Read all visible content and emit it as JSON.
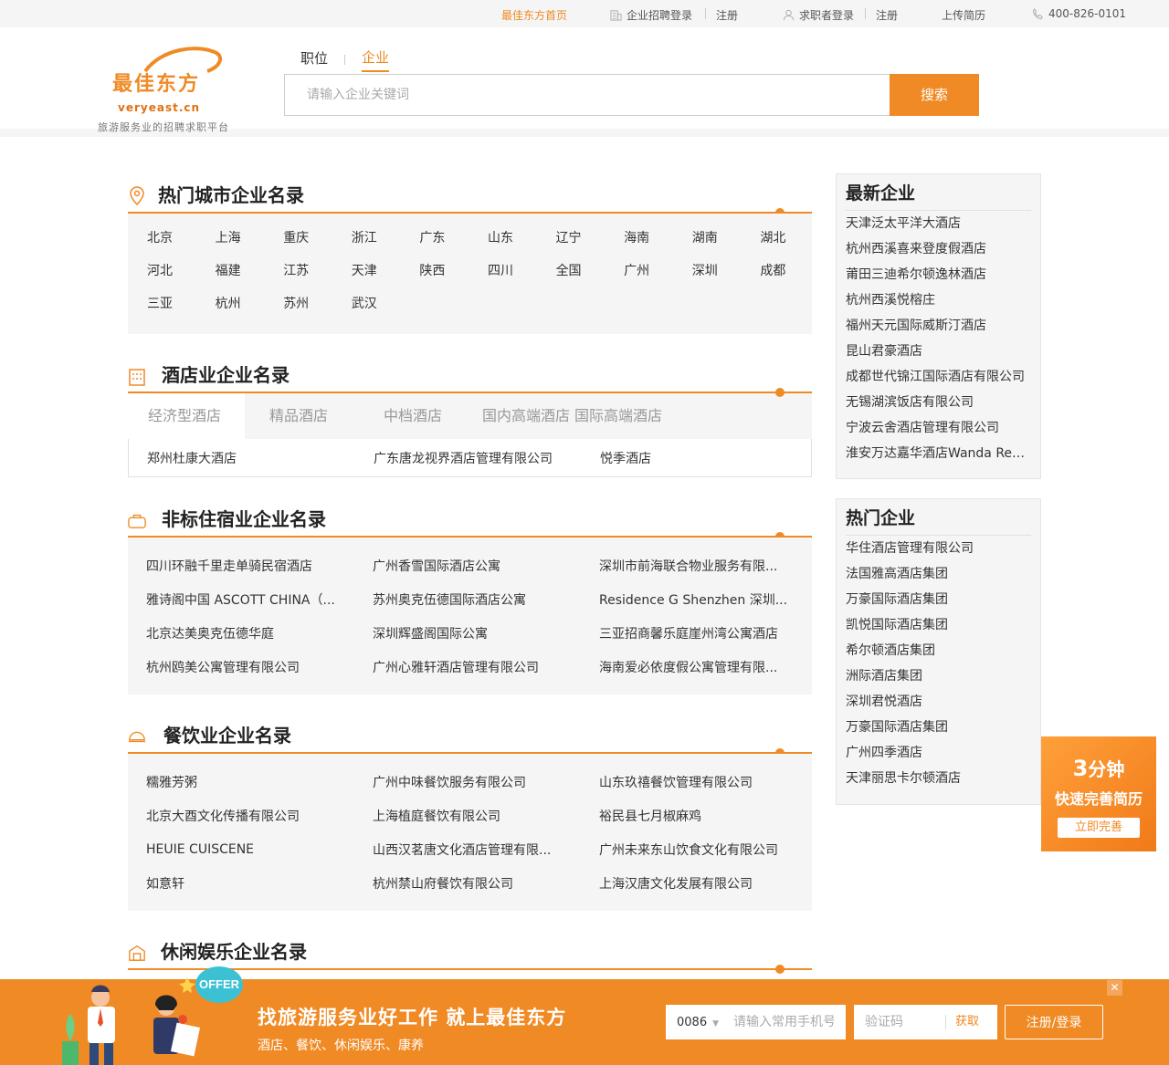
{
  "topbar": {
    "home": "最佳东方首页",
    "employer_login": "企业招聘登录",
    "employer_register": "注册",
    "seeker_login": "求职者登录",
    "seeker_register": "注册",
    "upload_resume": "上传简历",
    "phone": "400-826-0101"
  },
  "logo": {
    "cn": "最佳东方",
    "en": "veryeast.cn",
    "tagline": "旅游服务业的招聘求职平台"
  },
  "search": {
    "tabs": [
      "职位",
      "企业"
    ],
    "active_tab": "企业",
    "placeholder": "请输入企业关键词",
    "button": "搜索"
  },
  "sections": {
    "hot_cities": {
      "title": "热门城市企业名录",
      "cities": [
        [
          "北京",
          "上海",
          "重庆",
          "浙江",
          "广东",
          "山东",
          "辽宁",
          "海南",
          "湖南",
          "湖北"
        ],
        [
          "河北",
          "福建",
          "江苏",
          "天津",
          "陕西",
          "四川",
          "全国",
          "广州",
          "深圳",
          "成都"
        ],
        [
          "三亚",
          "杭州",
          "苏州",
          "武汉"
        ]
      ]
    },
    "hotel": {
      "title": "酒店业企业名录",
      "tabs": [
        "经济型酒店",
        "精品酒店",
        "中档酒店",
        "国内高端酒店",
        "国际高端酒店"
      ],
      "active_tab": "经济型酒店",
      "items": [
        "郑州杜康大酒店",
        "广东唐龙视界酒店管理有限公司",
        "悦季酒店"
      ]
    },
    "nonstandard": {
      "title": "非标住宿业企业名录",
      "items": [
        [
          "四川环融千里走单骑民宿酒店",
          "广州香雪国际酒店公寓",
          "深圳市前海联合物业服务有限..."
        ],
        [
          "雅诗阁中国 ASCOTT CHINA（...",
          "苏州奥克伍德国际酒店公寓",
          "Residence G Shenzhen 深圳..."
        ],
        [
          "北京达美奥克伍德华庭",
          "深圳辉盛阁国际公寓",
          "三亚招商馨乐庭崖州湾公寓酒店"
        ],
        [
          "杭州鸥美公寓管理有限公司",
          "广州心雅轩酒店管理有限公司",
          "海南爱必依度假公寓管理有限..."
        ]
      ]
    },
    "catering": {
      "title": "餐饮业企业名录",
      "items": [
        [
          "糯雅芳粥",
          "广州中味餐饮服务有限公司",
          "山东玖禧餐饮管理有限公司"
        ],
        [
          "北京大酉文化传播有限公司",
          "上海植庭餐饮有限公司",
          "裕民县七月椒麻鸡"
        ],
        [
          "HEUIE CUISCENE",
          "山西汉茗唐文化酒店管理有限...",
          "广州未来东山饮食文化有限公司"
        ],
        [
          "如意轩",
          "杭州禁山府餐饮有限公司",
          "上海汉唐文化发展有限公司"
        ]
      ]
    },
    "leisure": {
      "title": "休闲娱乐企业名录"
    }
  },
  "sidebar": {
    "latest": {
      "title": "最新企业",
      "items": [
        "天津泛太平洋大酒店",
        "杭州西溪喜来登度假酒店",
        "莆田三迪希尔顿逸林酒店",
        "杭州西溪悦榕庄",
        "福州天元国际威斯汀酒店",
        "昆山君豪酒店",
        "成都世代锦江国际酒店有限公司",
        "无锡湖滨饭店有限公司",
        "宁波云舍酒店管理有限公司",
        "淮安万达嘉华酒店Wanda Real..."
      ]
    },
    "hot": {
      "title": "热门企业",
      "items": [
        "华住酒店管理有限公司",
        "法国雅高酒店集团",
        "万豪国际酒店集团",
        "凯悦国际酒店集团",
        "希尔顿酒店集团",
        "洲际酒店集团",
        "深圳君悦酒店",
        "万豪国际酒店集团",
        "广州四季酒店",
        "天津丽思卡尔顿酒店"
      ]
    }
  },
  "promo": {
    "line1_num": "3",
    "line1_text": "分钟",
    "line2": "快速完善简历",
    "button": "立即完善"
  },
  "bottombar": {
    "badge": "OFFER",
    "slogan": "找旅游服务业好工作 就上最佳东方",
    "sub": "酒店、餐饮、休闲娱乐、康养",
    "country_code": "0086",
    "phone_placeholder": "请输入常用手机号",
    "code_placeholder": "验证码",
    "get_code": "获取",
    "submit": "注册/登录",
    "close": "✕"
  },
  "colors": {
    "accent": "#f08a24",
    "bg_gray": "#f5f5f5"
  }
}
